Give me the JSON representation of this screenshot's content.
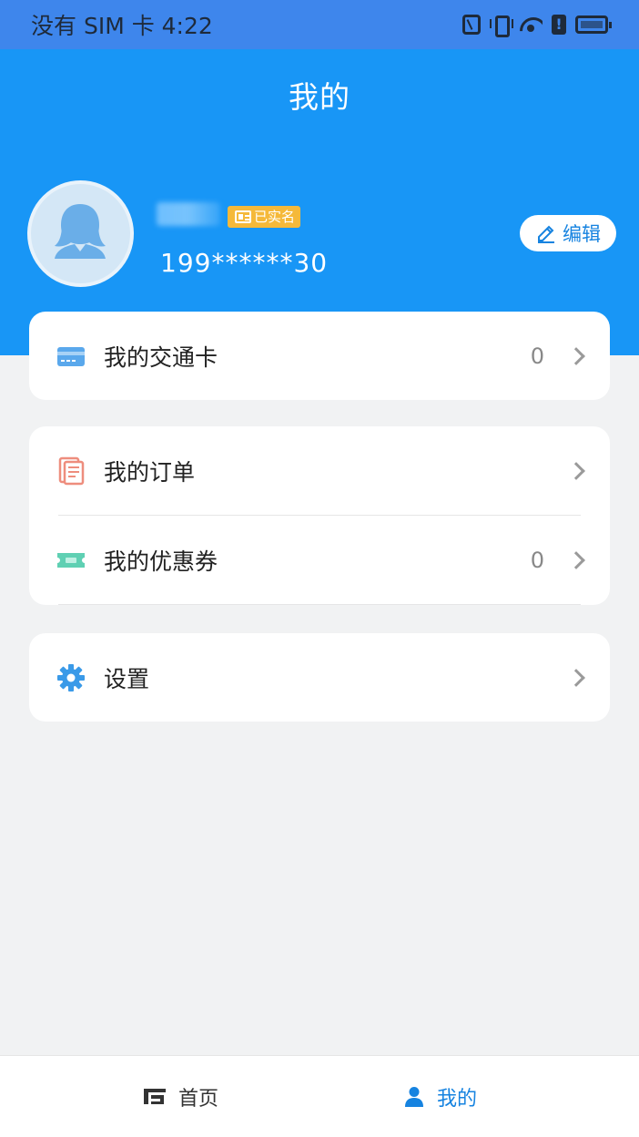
{
  "status_bar": {
    "carrier_time": "没有 SIM 卡 4:22",
    "icons": [
      "nfc-icon",
      "vibrate-icon",
      "wifi-icon",
      "alert-icon",
      "battery-icon"
    ]
  },
  "header": {
    "title": "我的",
    "verified_label": "已实名",
    "phone": "199******30",
    "edit_label": "编辑"
  },
  "menu": {
    "transit_card": {
      "label": "我的交通卡",
      "count": "0"
    },
    "orders": {
      "label": "我的订单"
    },
    "coupons": {
      "label": "我的优惠券",
      "count": "0"
    },
    "settings": {
      "label": "设置"
    }
  },
  "bottom_nav": {
    "home_label": "首页",
    "mine_label": "我的"
  },
  "colors": {
    "header_bg": "#1896f6",
    "status_bg": "#3e86ec",
    "accent": "#1683e0",
    "badge": "#f5b93a",
    "page_bg": "#f1f2f3"
  }
}
